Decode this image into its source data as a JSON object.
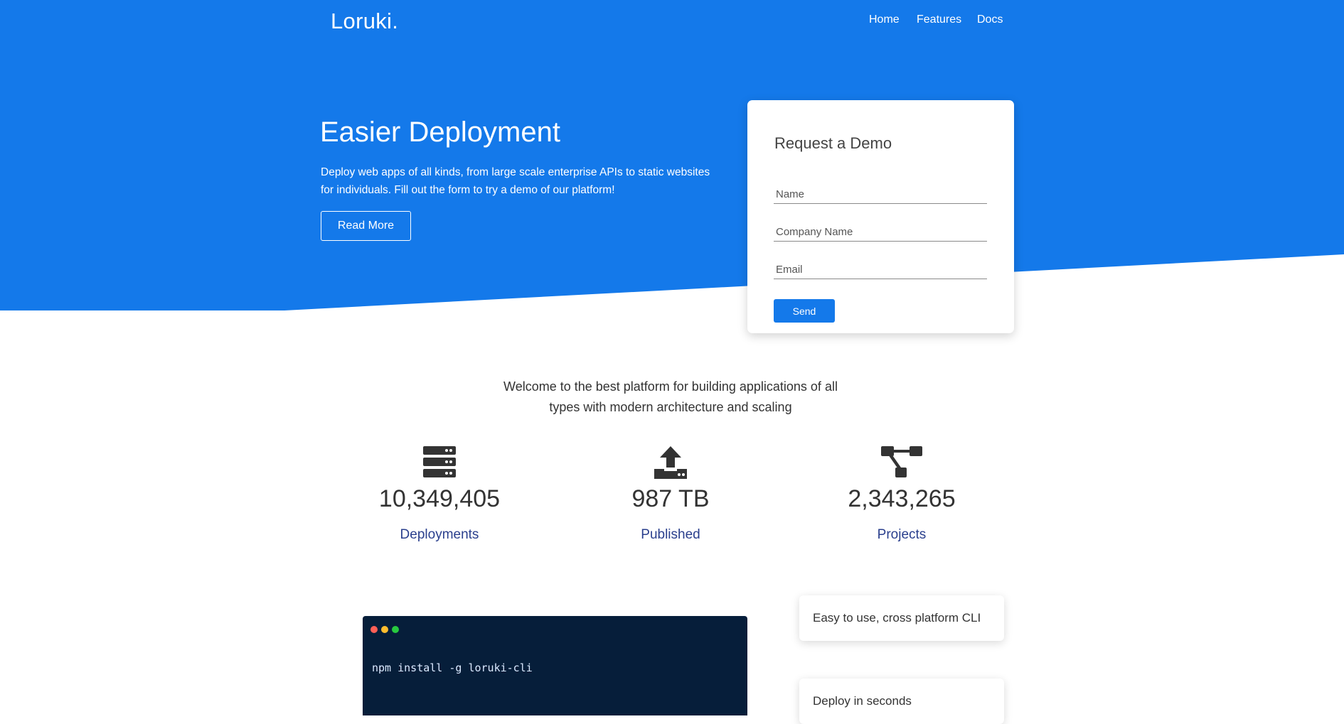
{
  "nav": {
    "logo": "Loruki.",
    "links": [
      "Home",
      "Features",
      "Docs"
    ]
  },
  "hero": {
    "title": "Easier Deployment",
    "description": "Deploy web apps of all kinds, from large scale enterprise APIs to static websites for individuals. Fill out the form to try a demo of our platform!",
    "button_label": "Read More"
  },
  "demo_form": {
    "title": "Request a Demo",
    "name_placeholder": "Name",
    "company_placeholder": "Company Name",
    "email_placeholder": "Email",
    "send_label": "Send"
  },
  "welcome": {
    "text": "Welcome to the best platform for building applications of all types with modern architecture and scaling"
  },
  "stats": [
    {
      "icon": "server-icon",
      "value": "10,349,405",
      "label": "Deployments"
    },
    {
      "icon": "upload-icon",
      "value": "987 TB",
      "label": "Published"
    },
    {
      "icon": "project-diagram-icon",
      "value": "2,343,265",
      "label": "Projects"
    }
  ],
  "terminal": {
    "command": "npm install -g loruki-cli"
  },
  "features": [
    {
      "label": "Easy to use, cross platform CLI"
    },
    {
      "label": "Deploy in seconds"
    }
  ],
  "colors": {
    "primary": "#1479ea",
    "terminal_bg": "#061e3a",
    "stat_label": "#2a3f8d",
    "dot_red": "#ff5f56",
    "dot_yellow": "#ffbd2e",
    "dot_green": "#27c93f"
  }
}
